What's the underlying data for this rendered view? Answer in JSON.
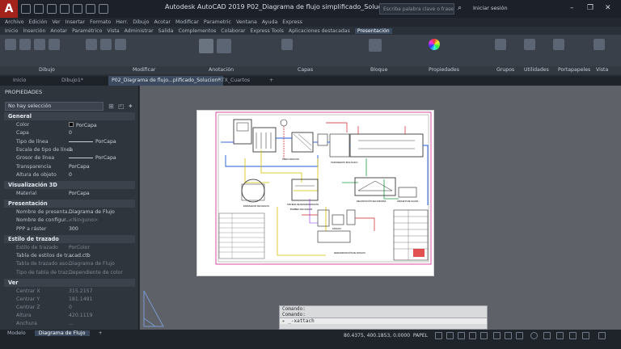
{
  "app": {
    "title": "Autodesk AutoCAD 2019    P02_Diagrama de flujo simplificado_Solucion.dwg",
    "logo": "A",
    "search_placeholder": "Escriba palabra clave o frase",
    "signin": "Iniciar sesión"
  },
  "menu": [
    "Archivo",
    "Edición",
    "Ver",
    "Insertar",
    "Formato",
    "Herr.",
    "Dibujo",
    "Acotar",
    "Modificar",
    "Parametric",
    "Ventana",
    "Ayuda",
    "Express"
  ],
  "ribbon_tabs": [
    "Inicio",
    "Inserción",
    "Anotar",
    "Paramétrico",
    "Vista",
    "Administrar",
    "Salida",
    "Complementos",
    "Colaborar",
    "Express Tools",
    "Aplicaciones destacadas",
    "Presentación"
  ],
  "ribbon_active": "Presentación",
  "ribbon_panels": [
    "Dibujo",
    "Modificar",
    "Anotación",
    "Capas",
    "Bloque",
    "Propiedades",
    "Grupos",
    "Utilidades",
    "Portapapeles",
    "Vista"
  ],
  "doc_tabs": [
    "Inicio",
    "Dibujo1*",
    "P02_Diagrama de flujo...plificado_Solucion*",
    "RTX_Cuartos"
  ],
  "doc_active": "P02_Diagrama de flujo...plificado_Solucion*",
  "properties": {
    "title": "PROPIEDADES",
    "selection": "No hay selección",
    "general": {
      "header": "General",
      "rows": [
        {
          "label": "Color",
          "value": "PorCapa"
        },
        {
          "label": "Capa",
          "value": "0"
        },
        {
          "label": "Tipo de línea",
          "value": "PorCapa"
        },
        {
          "label": "Escala de tipo de línea",
          "value": "1"
        },
        {
          "label": "Grosor de línea",
          "value": "PorCapa"
        },
        {
          "label": "Transparencia",
          "value": "PorCapa"
        },
        {
          "label": "Altura de objeto",
          "value": "0"
        }
      ]
    },
    "viz3d": {
      "header": "Visualización 3D",
      "rows": [
        {
          "label": "Material",
          "value": "PorCapa"
        }
      ]
    },
    "presentacion": {
      "header": "Presentación",
      "rows": [
        {
          "label": "Nombre de presenta...",
          "value": "Diagrama de Flujo"
        },
        {
          "label": "Nombre de configur...",
          "value": "<Ninguno>"
        },
        {
          "label": "PPP a ráster",
          "value": "300"
        }
      ]
    },
    "estilo": {
      "header": "Estilo de trazado",
      "rows": [
        {
          "label": "Estilo de trazado",
          "value": "PorColor"
        },
        {
          "label": "Tabla de estilos de tr...",
          "value": "acad.ctb"
        },
        {
          "label": "Tabla de trazado aso...",
          "value": "Diagrama de Flujo"
        },
        {
          "label": "Tipo de tabla de traz...",
          "value": "Dependiente de color"
        }
      ]
    },
    "ver": {
      "header": "Ver",
      "rows": [
        {
          "label": "Centrar X",
          "value": "315.2157"
        },
        {
          "label": "Centrar Y",
          "value": "181.1491"
        },
        {
          "label": "Centrar Z",
          "value": "0"
        },
        {
          "label": "Altura",
          "value": "420.1119"
        },
        {
          "label": "Anchura",
          "value": "..."
        }
      ]
    }
  },
  "command": {
    "history": [
      "Comando:",
      "Comando:"
    ],
    "input": "_-xattach"
  },
  "layout_tabs": [
    "Modelo",
    "Diagrama de Flujo",
    "+"
  ],
  "layout_active": "Diagrama de Flujo",
  "status": {
    "coords": "80.4375, 400.1853, 0.0000",
    "space": "PAPEL"
  },
  "drawing": {
    "labels": [
      "PRECLORACION",
      "TRATAMIENTO BIOLÓGICO",
      "ESPESADOR DE FANGOS",
      "SISTEMA DE DESHIDRATACIÓN",
      "BOMBEO DE FANGOS",
      "DECANTACIÓN SECUNDARIA",
      "ARQUETA DE SALIDA",
      "FANGOS",
      "DESHIDRATACIÓN DE FANGOS"
    ]
  },
  "colors": {
    "accent": "#3b4a5e",
    "autocad_red": "#a3221c",
    "paper_border": "#d21e8a"
  }
}
